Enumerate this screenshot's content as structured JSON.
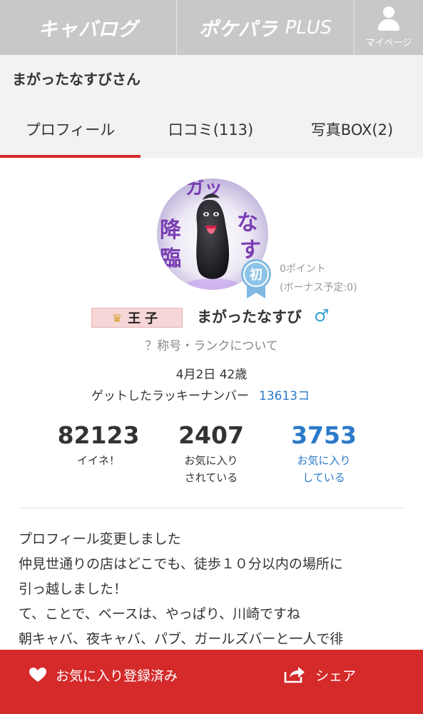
{
  "topnav": {
    "brand1": "キャバログ",
    "brand2": "ポケパラ",
    "brand2_plus": "PLUS",
    "mypage": "マイページ"
  },
  "user": {
    "title": "まがったなすびさん"
  },
  "tabs": [
    {
      "label": "プロフィール",
      "active": true
    },
    {
      "label": "口コミ(113)",
      "active": false
    },
    {
      "label": "写真BOX(2)",
      "active": false
    }
  ],
  "profile": {
    "badge": "初",
    "points": "0ポイント",
    "bonus": "(ボーナス予定:0)",
    "rank": "王子",
    "nickname": "まがったなすび",
    "gender_icon": "♂",
    "help_link": "？称号・ランクについて",
    "birth": "4月2日 42歳",
    "lucky_label": "ゲットしたラッキーナンバー",
    "lucky_number": "13613コ"
  },
  "stats": [
    {
      "value": "82123",
      "label1": "イイネ！",
      "label2": ""
    },
    {
      "value": "2407",
      "label1": "お気に入り",
      "label2": "されている"
    },
    {
      "value": "3753",
      "label1": "お気に入り",
      "label2": "している"
    }
  ],
  "bio": [
    "プロフィール変更しました",
    "仲見世通りの店はどこでも、徒歩１０分以内の場所に",
    "引っ越しました！",
    "て、ことで、ベースは、やっぱり、川崎ですね",
    "朝キャバ、夜キャバ、パブ、ガールズバーと一人で徘"
  ],
  "bottom": {
    "favorite": "お気に入り登録済み",
    "share": "シェア"
  },
  "colors": {
    "accent": "#d42a2a",
    "link": "#2a7ac9",
    "nav_bg": "#c8c8c8",
    "male": "#3aa3d8"
  }
}
